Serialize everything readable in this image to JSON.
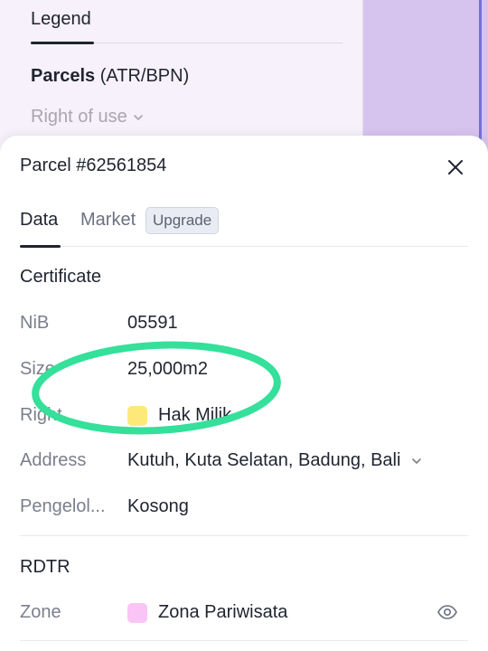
{
  "legend": {
    "tab_label": "Legend",
    "title_bold": "Parcels",
    "title_rest": " (ATR/BPN)",
    "subtitle": "Right of use"
  },
  "sheet": {
    "title": "Parcel #62561854",
    "tabs": [
      {
        "label": "Data",
        "active": true
      },
      {
        "label": "Market",
        "active": false
      }
    ],
    "upgrade_badge": "Upgrade"
  },
  "certificate": {
    "section_title": "Certificate",
    "rows": [
      {
        "label": "NiB",
        "value": "05591"
      },
      {
        "label": "Size",
        "value": "25,000m2"
      },
      {
        "label": "Right",
        "value": "Hak Milik",
        "swatch_color": "#fde97a"
      },
      {
        "label": "Address",
        "value": "Kutuh, Kuta Selatan, Badung, Bali"
      },
      {
        "label": "Pengelol...",
        "value": "Kosong"
      }
    ]
  },
  "rdtr": {
    "section_title": "RDTR",
    "rows": [
      {
        "label": "Zone",
        "value": "Zona Pariwisata",
        "swatch_color": "#fbc4f6"
      }
    ]
  },
  "colors": {
    "annotation": "#34e09a",
    "accent_text": "#1f2430",
    "muted_text": "#7a7f8c"
  }
}
